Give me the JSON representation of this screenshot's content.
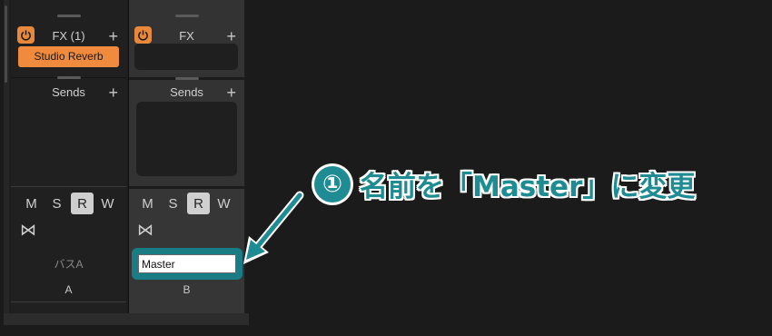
{
  "strips": [
    {
      "fx": {
        "title": "FX (1)",
        "plugin": "Studio Reverb"
      },
      "sends": {
        "title": "Sends"
      },
      "buttons": [
        "M",
        "S",
        "R",
        "W"
      ],
      "active_button": "R",
      "name": "バスA",
      "letter": "A"
    },
    {
      "fx": {
        "title": "FX"
      },
      "sends": {
        "title": "Sends"
      },
      "buttons": [
        "M",
        "S",
        "R",
        "W"
      ],
      "active_button": "R",
      "name_input_value": "Master",
      "letter": "B"
    }
  ],
  "icons": {
    "power": "power-icon",
    "add": "plus-icon",
    "link": "bowtie-link-icon"
  },
  "annotation": {
    "number": "①",
    "text": "名前を「Master」に変更"
  },
  "colors": {
    "power_accent": "#e8883a",
    "plugin_bg": "#f08a3c",
    "annotation_teal": "#1f8b93",
    "highlight_border": "#1a7d86"
  }
}
